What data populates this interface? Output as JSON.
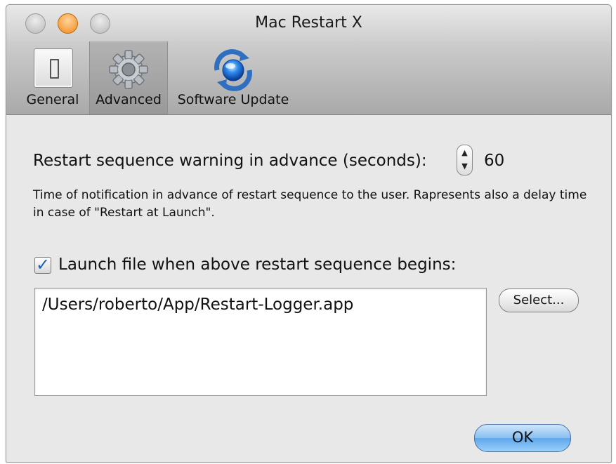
{
  "window": {
    "title": "Mac Restart X"
  },
  "toolbar": {
    "items": [
      {
        "label": "General",
        "icon": "switch-icon"
      },
      {
        "label": "Advanced",
        "icon": "gear-icon",
        "selected": true
      },
      {
        "label": "Software Update",
        "icon": "software-update-icon"
      }
    ]
  },
  "warning": {
    "label": "Restart sequence warning in advance (seconds):",
    "value": "60",
    "description": "Time of notification in advance of restart sequence to the user. Rapresents also a delay time in case of \"Restart at Launch\"."
  },
  "launch": {
    "checked": true,
    "label": "Launch file when above restart sequence begins:",
    "path": "/Users/roberto/App/Restart-Logger.app",
    "select_label": "Select..."
  },
  "ok_label": "OK",
  "colors": {
    "ok_button": "#7fb8ef",
    "checkmark": "#1f5fc0",
    "minimize": "#f08a1a"
  }
}
